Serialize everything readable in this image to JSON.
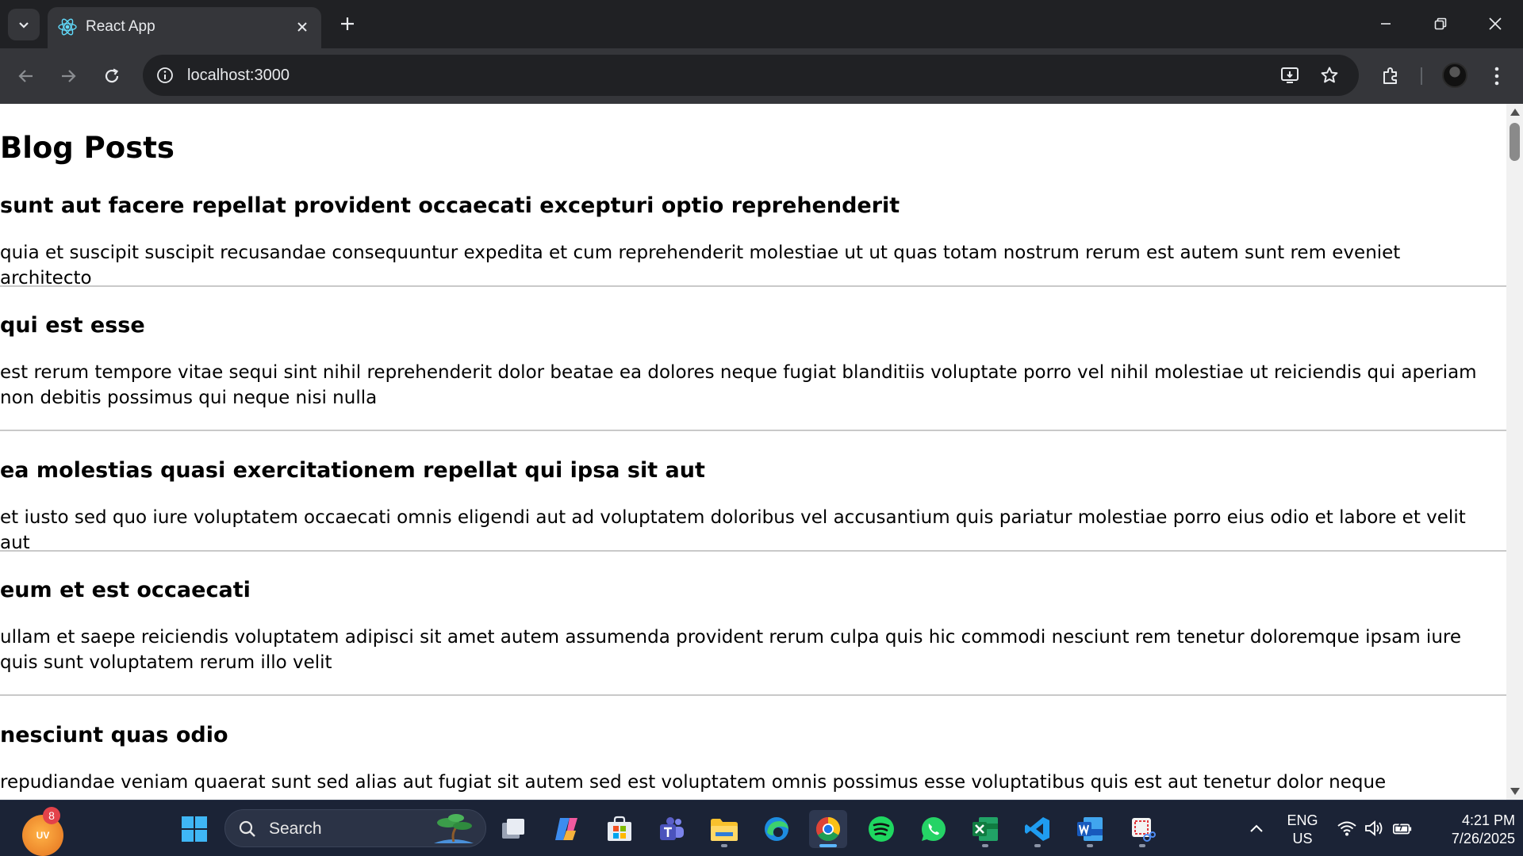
{
  "browser": {
    "tab": {
      "title": "React App",
      "favicon": "react-icon"
    },
    "address_bar": {
      "url": "localhost:3000"
    },
    "icons": [
      "tab-search-icon",
      "close-icon",
      "plus-icon",
      "minimize-icon",
      "restore-icon",
      "close-window-icon",
      "back-icon",
      "forward-icon",
      "reload-icon",
      "site-info-icon",
      "install-app-icon",
      "star-icon",
      "extensions-icon",
      "profile-avatar",
      "menu-icon"
    ]
  },
  "page": {
    "heading": "Blog Posts",
    "posts": [
      {
        "title": "sunt aut facere repellat provident occaecati excepturi optio reprehenderit",
        "body": "quia et suscipit suscipit recusandae consequuntur expedita et cum reprehenderit molestiae ut ut quas totam nostrum rerum est autem sunt rem eveniet architecto"
      },
      {
        "title": "qui est esse",
        "body": "est rerum tempore vitae sequi sint nihil reprehenderit dolor beatae ea dolores neque fugiat blanditiis voluptate porro vel nihil molestiae ut reiciendis qui aperiam non debitis possimus qui neque nisi nulla"
      },
      {
        "title": "ea molestias quasi exercitationem repellat qui ipsa sit aut",
        "body": "et iusto sed quo iure voluptatem occaecati omnis eligendi aut ad voluptatem doloribus vel accusantium quis pariatur molestiae porro eius odio et labore et velit aut"
      },
      {
        "title": "eum et est occaecati",
        "body": "ullam et saepe reiciendis voluptatem adipisci sit amet autem assumenda provident rerum culpa quis hic commodi nesciunt rem tenetur doloremque ipsam iure quis sunt voluptatem rerum illo velit"
      },
      {
        "title": "nesciunt quas odio",
        "body": "repudiandae veniam quaerat sunt sed alias aut fugiat sit autem sed est voluptatem omnis possimus esse voluptatibus quis est aut tenetur dolor neque"
      }
    ]
  },
  "taskbar": {
    "weather": {
      "label": "UV",
      "badge": "8"
    },
    "search": {
      "placeholder": "Search"
    },
    "apps": [
      "start-icon",
      "task-view-icon",
      "copilot-icon",
      "microsoft-store-icon",
      "teams-icon",
      "file-explorer-icon",
      "edge-icon",
      "chrome-icon",
      "spotify-icon",
      "whatsapp-icon",
      "excel-icon",
      "vscode-icon",
      "word-icon",
      "snipping-tool-icon"
    ],
    "active_app": "chrome-icon",
    "tray": {
      "language_line1": "ENG",
      "language_line2": "US",
      "time": "4:21 PM",
      "date": "7/26/2025"
    }
  },
  "colors": {
    "chrome_dark": "#202124",
    "chrome_toolbar": "#35363a",
    "taskbar": "#1b2336",
    "page_bg": "#ffffff",
    "divider": "#c9c9c9"
  }
}
